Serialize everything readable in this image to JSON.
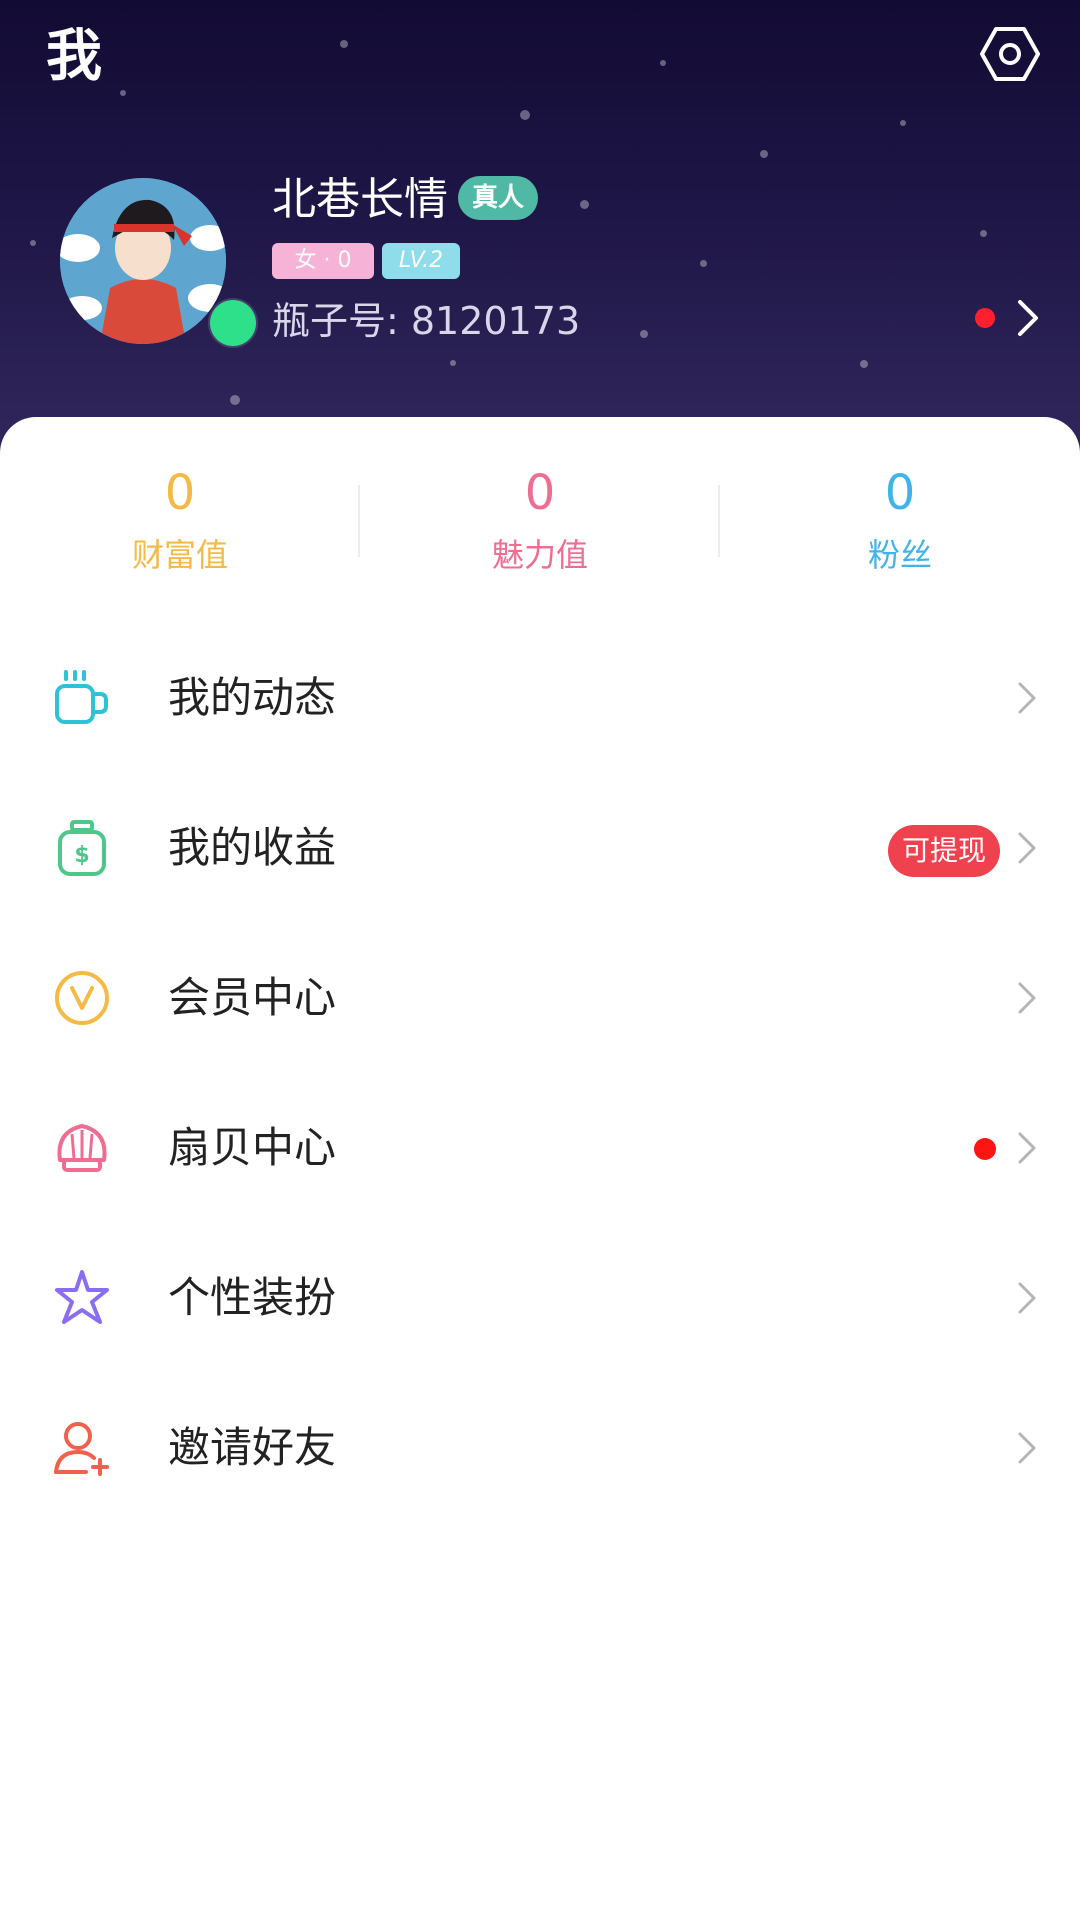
{
  "header": {
    "title": "我",
    "settings_icon": "settings-hexagon-icon"
  },
  "profile": {
    "nickname": "北巷长情",
    "verify_badge": "真人",
    "gender_badge": "女 · 0",
    "level_badge": "LV.2",
    "bottle_id": "瓶子号: 8120173",
    "online": true,
    "has_notification_dot": true
  },
  "stats": [
    {
      "value": "0",
      "label": "财富值",
      "color": "#f5b945"
    },
    {
      "value": "0",
      "label": "魅力值",
      "color": "#f06d91"
    },
    {
      "value": "0",
      "label": "粉丝",
      "color": "#3fb4e8"
    }
  ],
  "menu": [
    {
      "label": "我的动态",
      "icon": "cup-icon",
      "color": "#2dc2d6"
    },
    {
      "label": "我的收益",
      "icon": "money-bag-icon",
      "color": "#4ec88a",
      "badge": "可提现"
    },
    {
      "label": "会员中心",
      "icon": "vip-v-icon",
      "color": "#f5b945"
    },
    {
      "label": "扇贝中心",
      "icon": "shell-icon",
      "color": "#f06d91",
      "red_dot": true
    },
    {
      "label": "个性装扮",
      "icon": "star-icon",
      "color": "#8a6df0"
    },
    {
      "label": "邀请好友",
      "icon": "add-friend-icon",
      "color": "#f0604d"
    }
  ],
  "colors": {
    "header_bg_top": "#120b33",
    "header_bg_bottom": "#33285e",
    "badge_red": "#f0414e",
    "dot_red": "#ff1414"
  }
}
